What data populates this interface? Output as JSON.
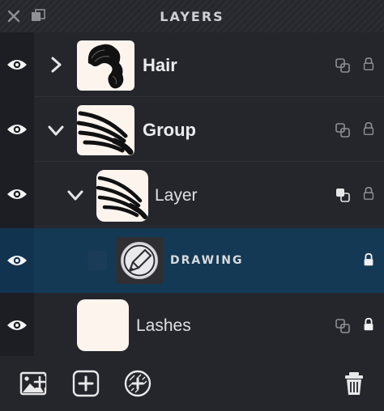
{
  "header": {
    "title": "LAYERS",
    "close_icon": "close-icon",
    "duplicate_icon": "stack-icon"
  },
  "layers": [
    {
      "name": "Hair",
      "expanded": false,
      "visible": true,
      "locked": false,
      "thumbnail": "hair"
    },
    {
      "name": "Group",
      "expanded": true,
      "visible": true,
      "locked": false,
      "thumbnail": "lashes-strokes"
    },
    {
      "name": "Layer",
      "expanded": true,
      "visible": true,
      "locked": false,
      "thumbnail": "lashes-strokes",
      "mask_active": true
    },
    {
      "name": "DRAWING",
      "visible": true,
      "locked": true,
      "selected": true,
      "thumbnail": "pencil-icon"
    },
    {
      "name": "Lashes",
      "visible": true,
      "locked": true,
      "thumbnail": "blank"
    }
  ],
  "footer": {
    "buttons": [
      "add-image-icon",
      "add-layer-icon",
      "add-group-icon",
      "trash-icon"
    ]
  },
  "colors": {
    "panel_bg": "#25262c",
    "eye_column": "#1d1e23",
    "selected_row": "#133955",
    "accent_text": "#ececef"
  }
}
